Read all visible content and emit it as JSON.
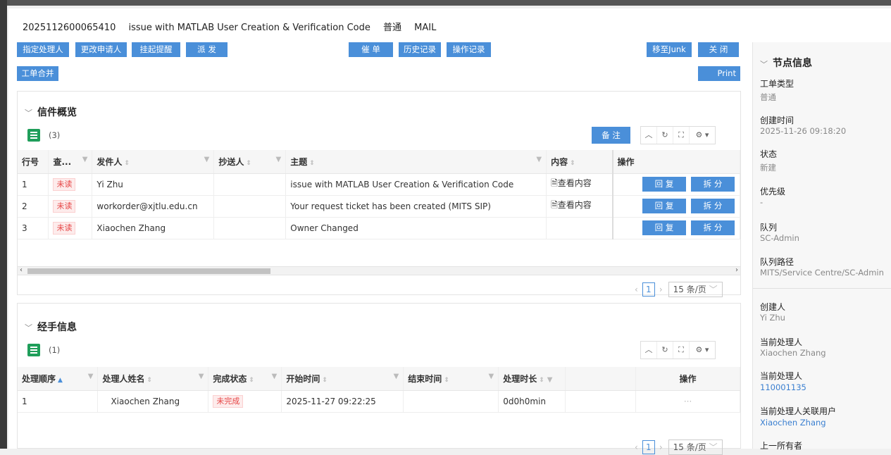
{
  "header": {
    "ticket_id": "2025112600065410",
    "subject": "issue with MATLAB User Creation & Verification Code",
    "priority": "普通",
    "channel": "MAIL"
  },
  "toolbar": {
    "assign": "指定处理人",
    "change_applicant": "更改申请人",
    "suspend": "挂起提醒",
    "dispatch": "派 发",
    "urge": "催 单",
    "history": "历史记录",
    "op_log": "操作记录",
    "move_junk": "移至Junk",
    "close": "关 闭",
    "merge": "工单合并",
    "print": "Print"
  },
  "mail": {
    "title": "信件概览",
    "count": "(3)",
    "note_btn": "备 注",
    "columns": [
      "行号",
      "查...",
      "发件人",
      "抄送人",
      "主题",
      "内容",
      "操作"
    ],
    "rows": [
      {
        "no": "1",
        "status": "未读",
        "sender": "Yi Zhu",
        "cc": "",
        "subject": "issue with MATLAB User Creation & Verification Code",
        "content": "查看内容"
      },
      {
        "no": "2",
        "status": "未读",
        "sender": "workorder@xjtlu.edu.cn",
        "cc": "",
        "subject": "Your request ticket has been created (MITS SIP)",
        "content": "查看内容"
      },
      {
        "no": "3",
        "status": "未读",
        "sender": "Xiaochen Zhang",
        "cc": "",
        "subject": "Owner Changed",
        "content": ""
      }
    ],
    "reply": "回 复",
    "split": "拆 分",
    "page": "1",
    "page_size": "15 条/页"
  },
  "handlers": {
    "title": "经手信息",
    "count": "(1)",
    "columns": [
      "处理顺序",
      "处理人姓名",
      "完成状态",
      "开始时间",
      "结束时间",
      "处理时长",
      "操作"
    ],
    "rows": [
      {
        "order": "1",
        "name": "Xiaochen Zhang",
        "status": "未完成",
        "start": "2025-11-27 09:22:25",
        "end": "",
        "duration": "0d0h0min",
        "op": "···"
      }
    ],
    "page": "1",
    "page_size": "15 条/页"
  },
  "node_info": {
    "title": "节点信息",
    "fields": [
      {
        "label": "工单类型",
        "value": "普通"
      },
      {
        "label": "创建时间",
        "value": "2025-11-26 09:18:20"
      },
      {
        "label": "状态",
        "value": "新建"
      },
      {
        "label": "优先级",
        "value": "-"
      },
      {
        "label": "队列",
        "value": "SC-Admin"
      },
      {
        "label": "队列路径",
        "value": "MITS/Service Centre/SC-Admin"
      },
      {
        "label": "创建人",
        "value": "Yi Zhu"
      },
      {
        "label": "当前处理人",
        "value": "Xiaochen Zhang"
      },
      {
        "label": "当前处理人",
        "value": "110001135"
      },
      {
        "label": "当前处理人关联用户",
        "value": "Xiaochen Zhang"
      },
      {
        "label": "上一所有者",
        "value": ""
      }
    ]
  },
  "colors": {
    "accent": "#4a8fd9",
    "unread": "#e64545",
    "list_icon": "#1f9e5a"
  }
}
